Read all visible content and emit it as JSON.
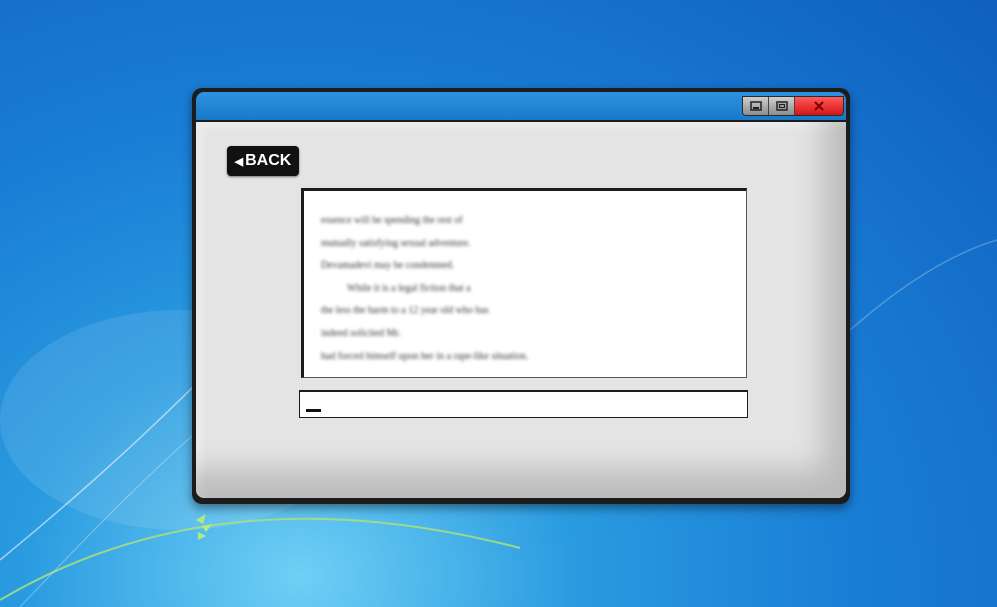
{
  "window": {
    "controls": [
      {
        "name": "minimize",
        "icon": "minimize-icon"
      },
      {
        "name": "maximize",
        "icon": "maximize-icon"
      },
      {
        "name": "close",
        "icon": "close-icon"
      }
    ]
  },
  "back_button": {
    "label": "BACK",
    "icon": "left-triangle-icon"
  },
  "text_panel": {
    "lines": [
      "essence will be spending the rest of",
      "mutually satisfying sexual adventure.",
      "Devamadevi may be condemned.",
      "While it is a legal fiction that a",
      "the less the harm to a 12 year old who has",
      "indeed solicited Mr.",
      "had forced himself upon her in a rape-like situation."
    ]
  },
  "input": {
    "value": ""
  },
  "colors": {
    "desktop": "#1a7fd6",
    "titlebar": "#1879c9",
    "client": "#e4e4e4",
    "close_button": "#e02020",
    "back_button": "#111111"
  }
}
